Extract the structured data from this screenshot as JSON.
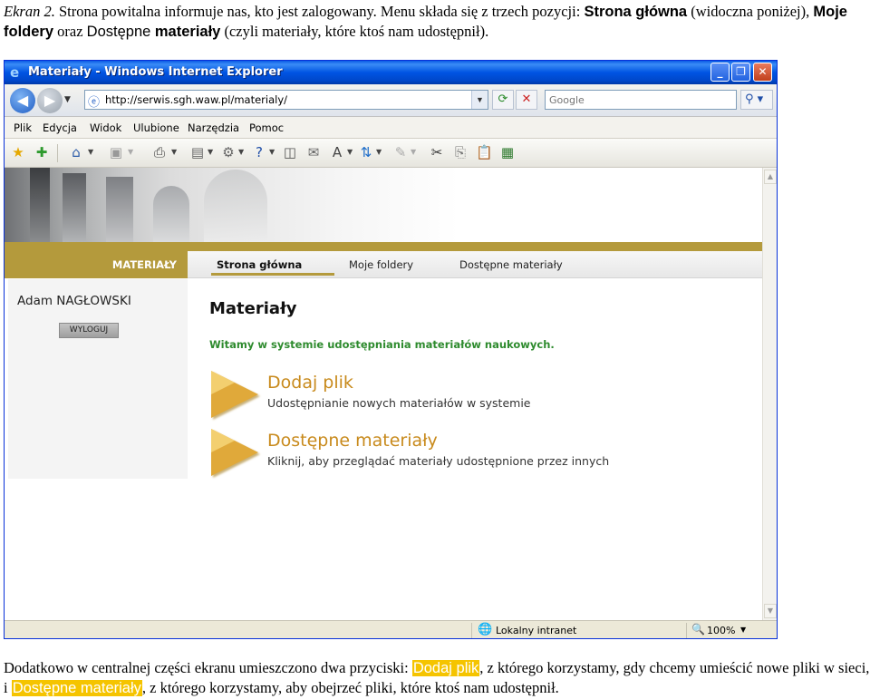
{
  "document": {
    "caption_label": "Ekran 2.",
    "top_text": {
      "p1": " Strona powitalna informuje nas, kto jest zalogowany. Menu składa się z trzech pozycji: ",
      "bold1": "Strona główna",
      "p2": " (widoczna poniżej), ",
      "bold2": "Moje foldery",
      "p3": " oraz ",
      "plain_sans": "Dostępne ",
      "bold3": "materiały",
      "p4": " (czyli materiały, które ktoś nam udostępnił)."
    },
    "bottom_text": {
      "p1": "Dodatkowo w centralnej części ekranu umieszczono dwa przyciski: ",
      "hl1": "Dodaj plik",
      "p2": ", z którego korzystamy, gdy chcemy umieścić nowe pliki w sieci, i ",
      "hl2": "Dostępne materiały",
      "p3": ", z którego korzystamy, aby obejrzeć pliki, które ktoś nam udostępnił."
    }
  },
  "browser": {
    "window_title": "Materiały - Windows Internet Explorer",
    "buttons": {
      "minimize": "_",
      "maximize": "❐",
      "close": "✕"
    },
    "address": "http://serwis.sgh.waw.pl/materialy/",
    "search_placeholder": "Google",
    "menu": [
      "Plik",
      "Edycja",
      "Widok",
      "Ulubione",
      "Narzędzia",
      "Pomoc"
    ],
    "status": {
      "zone": "Lokalny intranet",
      "zoom": "100%"
    }
  },
  "site": {
    "section_label": "MATERIAŁY",
    "nav": [
      "Strona główna",
      "Moje foldery",
      "Dostępne materiały"
    ],
    "active_nav": "Strona główna",
    "user_name": "Adam NAGŁOWSKI",
    "logout_label": "WYLOGUJ",
    "page_title": "Materiały",
    "welcome": "Witamy w systemie udostępniania materiałów naukowych.",
    "actions": [
      {
        "label": "Dodaj plik",
        "description": "Udostępnianie nowych materiałów w systemie"
      },
      {
        "label": "Dostępne materiały",
        "description": "Kliknij, aby przeglądać materiały udostępnione przez innych"
      }
    ]
  },
  "colors": {
    "accent_gold": "#b49a3c",
    "welcome_green": "#2e8b2e",
    "action_orange": "#c88a1c",
    "highlight_yellow": "#f5c400",
    "xp_title_blue": "#0054e3"
  },
  "icons": {
    "titlebar": "ie-icon",
    "nav": [
      "back-arrow-icon",
      "forward-arrow-icon"
    ],
    "toolbar": [
      "favorites-star-icon",
      "add-favorites-icon",
      "home-icon",
      "feeds-icon",
      "print-icon",
      "page-icon",
      "tools-gear-icon",
      "help-icon",
      "research-icon",
      "mail-icon",
      "font-size-icon",
      "translate-icon",
      "pen-icon",
      "cut-icon",
      "copy-icon",
      "paste-icon",
      "select-all-icon"
    ],
    "action": "gold-arrow-icon"
  }
}
